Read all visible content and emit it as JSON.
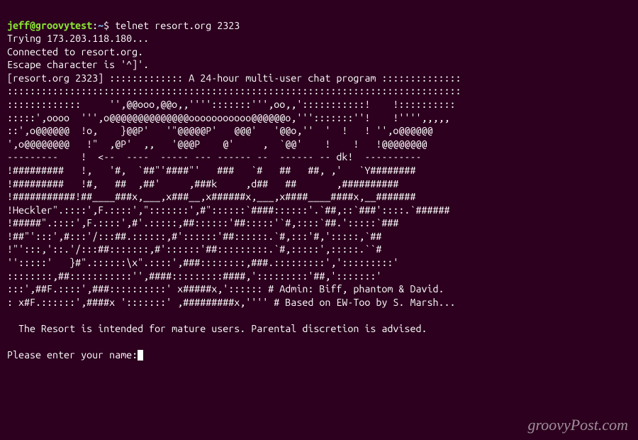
{
  "prompt": {
    "user_host": "jeff@groovytest",
    "separator": ":",
    "path": "~",
    "symbol": "$",
    "command": "telnet resort.org 2323"
  },
  "connect": {
    "line1": "Trying 173.203.118.180...",
    "line2": "Connected to resort.org.",
    "line3": "Escape character is '^]'."
  },
  "banner": {
    "l0": "[resort.org 2323] ::::::::::::: A 24-hour multi-user chat program ::::::::::::::",
    "l1": "::::::::::::::::::::::::::::::::::::::::::::::::::::::::::::::::::::::::::::::::",
    "l2": ":::::::::::::     '',@@ooo,@@o,,'''':::::::''',oo,,':::::::::::!    !::::::::::",
    "l3": ":::::',oooo  ''',o@@@@@@@@@@@@@@ooooooooooo@@@@@@o,''':::::::''!    !'''',,,,,",
    "l4": "::',o@@@@@@  !o,    }@@P'   '\"@@@@@P'   @@@'   '@@o,''  '  !   ! '',o@@@@@@",
    "l5": "',o@@@@@@@@   !\"  ,@P'  ,,   '@@@P    @'     ,  `@@'    !    !   !@@@@@@@@",
    "l6": "---------    !  <--  ----  ----- --- ------ --  ------ -- dk!  ----------",
    "l7": "!#########   !,   '#,  `##\"'####\"'   ###   `#   ##   ##, ,'   `Y########",
    "l8": "!#########   !#,   ##  ,##'     ,###k     ,d##   ##       ,##########",
    "l9": "!###########!##____###x,___,x###__,x######x,___,x####____####x,__#######",
    "l10": "!Heckler\".::::',F.::::',\":::::::',#\"::::::`####::::::'.`##,::`###'::::.`######",
    "l11": "!#####\".::::',F.::::',#'.:::::,##::::::'##:::::'`#,::::`##.':::::`###",
    "l12": "!##\"':::',#:::'/:::##.::::::,#'::::::'##::::::.`#,:::'#,':::::,`##",
    "l13": "!\"':::,'::.'/:::##:::::::,#'::::::'##:::::::::.`#,:::::',:::::.``#",
    "l14": "'':::::'   }#\".::::::\\x\".::::',###::::::::,###.:::::::::',':::::::::'",
    "l15": "::::::::,##:::::::::::'',####:::::::::####,':::::::::'##,':::::::'",
    "l16": ":::',##F.::::',###::::::::::' x#####x,':::::: # Admin: Biff, phantom & David.",
    "l17": ": x#F.::::::',####x ':::::::' ,#########x,'''' # Based on EW-Too by S. Marsh..."
  },
  "footer": {
    "notice": "  The Resort is intended for mature users. Parental discretion is advised.",
    "prompt_label": "Please enter your name:"
  },
  "watermark": "groovyPost.com"
}
